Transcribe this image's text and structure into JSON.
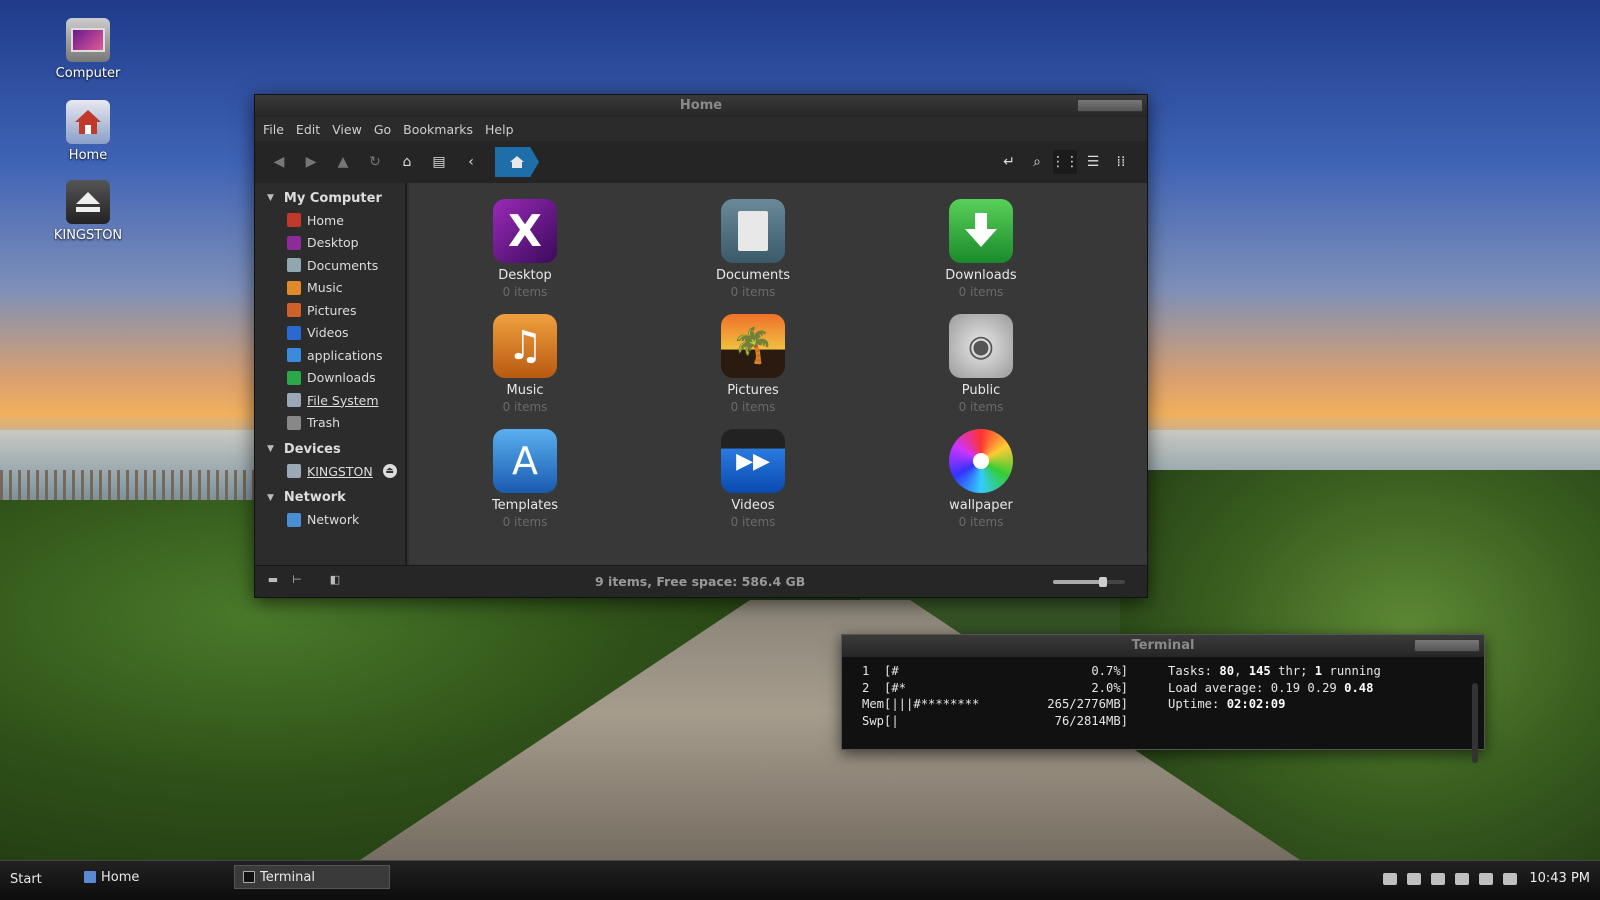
{
  "desktop": {
    "icons": [
      {
        "label": "Computer"
      },
      {
        "label": "Home"
      },
      {
        "label": "KINGSTON"
      }
    ]
  },
  "file_manager": {
    "title": "Home",
    "menu": [
      "File",
      "Edit",
      "View",
      "Go",
      "Bookmarks",
      "Help"
    ],
    "sidebar": {
      "sections": [
        {
          "title": "My Computer",
          "items": [
            "Home",
            "Desktop",
            "Documents",
            "Music",
            "Pictures",
            "Videos",
            "applications",
            "Downloads",
            "File System",
            "Trash"
          ]
        },
        {
          "title": "Devices",
          "items": [
            "KINGSTON"
          ]
        },
        {
          "title": "Network",
          "items": [
            "Network"
          ]
        }
      ]
    },
    "folders": [
      {
        "name": "Desktop",
        "count": "0 items"
      },
      {
        "name": "Documents",
        "count": "0 items"
      },
      {
        "name": "Downloads",
        "count": "0 items"
      },
      {
        "name": "Music",
        "count": "0 items"
      },
      {
        "name": "Pictures",
        "count": "0 items"
      },
      {
        "name": "Public",
        "count": "0 items"
      },
      {
        "name": "Templates",
        "count": "0 items"
      },
      {
        "name": "Videos",
        "count": "0 items"
      },
      {
        "name": "wallpaper",
        "count": "0 items"
      }
    ],
    "status": "9 items, Free space: 586.4 GB",
    "zoom_fraction": 0.7
  },
  "terminal": {
    "title": "Terminal",
    "lines": [
      {
        "left": "1  [#",
        "right": "0.7%]",
        "info_label": "Tasks: ",
        "info_parts": [
          "80",
          ", ",
          "145",
          " thr; ",
          "1",
          " running"
        ]
      },
      {
        "left": "2  [#*",
        "right": "2.0%]",
        "info_label": "Load average: ",
        "info_parts": [
          "0.19 0.29 ",
          "0.48"
        ]
      },
      {
        "left": "Mem[|||#********",
        "right": "265/2776MB]",
        "info_label": "Uptime: ",
        "info_parts": [
          "02:02:09"
        ]
      },
      {
        "left": "Swp[|",
        "right": "76/2814MB]",
        "info_label": "",
        "info_parts": []
      }
    ]
  },
  "taskbar": {
    "start": "Start",
    "tasks": [
      "Home",
      "Terminal"
    ],
    "clock": "10:43 PM"
  },
  "colors": {
    "accent": "#1e6eaa"
  }
}
